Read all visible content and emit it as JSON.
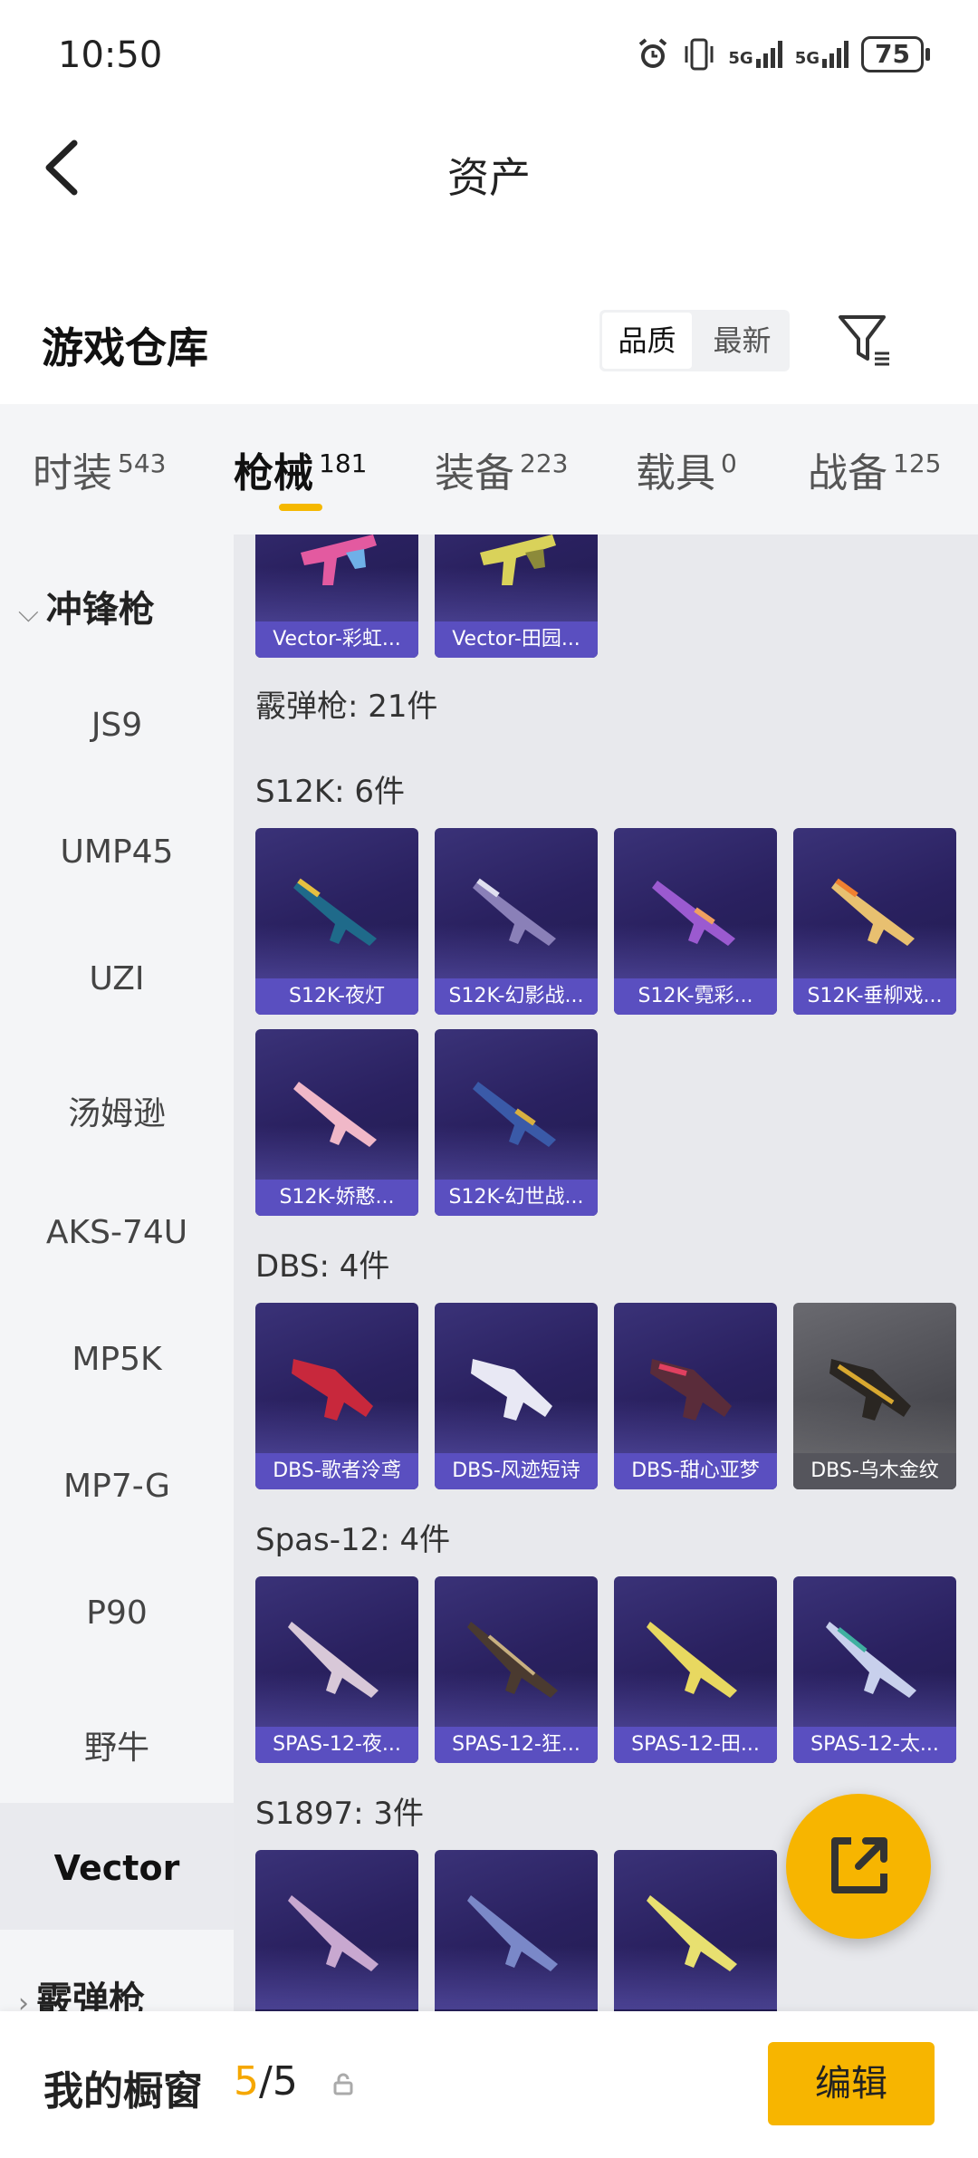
{
  "status_bar": {
    "time": "10:50",
    "signal_1": "5G",
    "signal_2": "5G",
    "battery": "75"
  },
  "header": {
    "title": "资产"
  },
  "warehouse": {
    "title": "游戏仓库",
    "sort_options": [
      "品质",
      "最新"
    ],
    "sort_selected": "品质"
  },
  "tabs": [
    {
      "label": "时装",
      "count": "543"
    },
    {
      "label": "枪械",
      "count": "181"
    },
    {
      "label": "装备",
      "count": "223"
    },
    {
      "label": "载具",
      "count": "0"
    },
    {
      "label": "战备",
      "count": "125"
    }
  ],
  "active_tab": "枪械",
  "sidebar": {
    "group_1": "冲锋枪",
    "items": [
      "JS9",
      "UMP45",
      "UZI",
      "汤姆逊",
      "AKS-74U",
      "MP5K",
      "MP7-G",
      "P90",
      "野牛",
      "Vector"
    ],
    "active_item": "Vector",
    "group_2": "霰弹枪"
  },
  "content": {
    "vector_cards": [
      "Vector-彩虹...",
      "Vector-田园..."
    ],
    "category_header": "霰弹枪: 21件",
    "s12k_label": "S12K: 6件",
    "s12k_cards": [
      "S12K-夜灯",
      "S12K-幻影战...",
      "S12K-霓彩...",
      "S12K-垂柳戏...",
      "S12K-娇憨...",
      "S12K-幻世战..."
    ],
    "dbs_label": "DBS: 4件",
    "dbs_cards": [
      "DBS-歌者泠鸢",
      "DBS-风迹短诗",
      "DBS-甜心亚梦",
      "DBS-乌木金纹"
    ],
    "spas_label": "Spas-12: 4件",
    "spas_cards": [
      "SPAS-12-夜...",
      "SPAS-12-狂...",
      "SPAS-12-田...",
      "SPAS-12-太..."
    ],
    "s1897_label": "S1897: 3件"
  },
  "bottom_bar": {
    "label": "我的橱窗",
    "used": "5",
    "total": "/5",
    "edit_button": "编辑"
  },
  "colors": {
    "accent": "#f7b500",
    "card_bg": "#2a2160",
    "card_label": "#5a4fc0",
    "grey_card": "#4a4a50"
  }
}
